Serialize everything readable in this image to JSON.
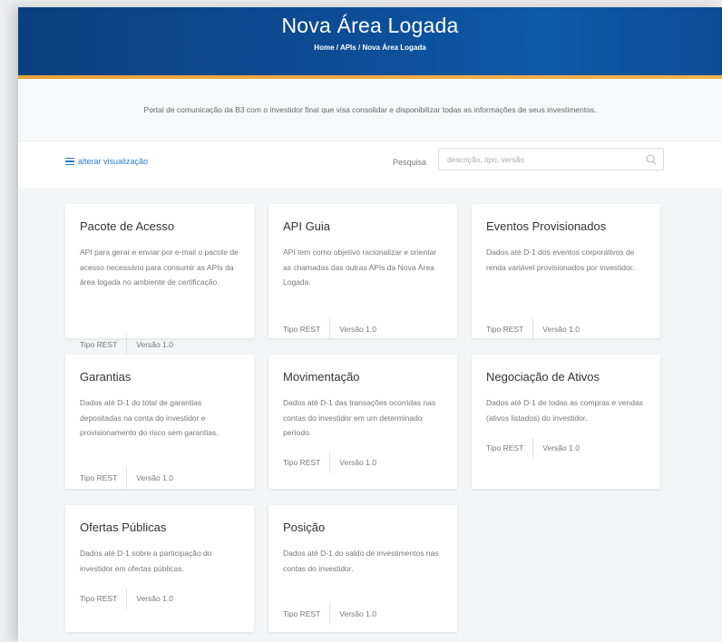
{
  "header": {
    "title": "Nova Área Logada",
    "breadcrumb": [
      "Home",
      "APIs",
      "Nova Área Logada"
    ],
    "breadcrumb_separator": "/"
  },
  "intro": {
    "text": "Portal de comunicação da B3 com o investidor final que visa consolidar e disponibilizar todas as informações de seus investimentos."
  },
  "toolbar": {
    "view_toggle_label": "alterar visualização",
    "search_label": "Pesquisa",
    "search_placeholder": "descrição, tipo, versão",
    "search_value": ""
  },
  "colors": {
    "header_blue": "#0d4c95",
    "accent_orange": "#f2b44a",
    "link_blue": "#2a7ad0"
  },
  "cards": [
    {
      "title": "Pacote de Acesso",
      "description": "API para gerar e enviar por e-mail o pacote de acesso necessário para consumir as APIs da área logada no ambiente de certificação.",
      "type_label": "Tipo",
      "type": "REST",
      "version_label": "Versão",
      "version": "1.0"
    },
    {
      "title": "API Guia",
      "description": "API tem como objetivo racionalizar e orientar as chamadas das outras APIs da Nova Área Logada.",
      "type_label": "Tipo",
      "type": "REST",
      "version_label": "Versão",
      "version": "1.0"
    },
    {
      "title": "Eventos Provisionados",
      "description": "Dados até D-1 dos eventos corporativos de renda variável provisionados por investidor.",
      "type_label": "Tipo",
      "type": "REST",
      "version_label": "Versão",
      "version": "1.0"
    },
    {
      "title": "Garantias",
      "description": "Dados até D-1 do total de garantias depositadas na conta do investidor e provisionamento do risco sem garantias.",
      "type_label": "Tipo",
      "type": "REST",
      "version_label": "Versão",
      "version": "1.0"
    },
    {
      "title": "Movimentação",
      "description": "Dados até D-1 das transações ocorridas nas contas do investidor em um determinado período.",
      "type_label": "Tipo",
      "type": "REST",
      "version_label": "Versão",
      "version": "1.0"
    },
    {
      "title": "Negociação de Ativos",
      "description": "Dados até D-1 de todas as compras e vendas (ativos listados) do investidor.",
      "type_label": "Tipo",
      "type": "REST",
      "version_label": "Versão",
      "version": "1.0"
    },
    {
      "title": "Ofertas Públicas",
      "description": "Dados até D-1 sobre a participação do investidor em ofertas públicas.",
      "type_label": "Tipo",
      "type": "REST",
      "version_label": "Versão",
      "version": "1.0"
    },
    {
      "title": "Posição",
      "description": "Dados até D-1 do saldo de investimentos nas contas do investidor.",
      "type_label": "Tipo",
      "type": "REST",
      "version_label": "Versão",
      "version": "1.0"
    }
  ]
}
